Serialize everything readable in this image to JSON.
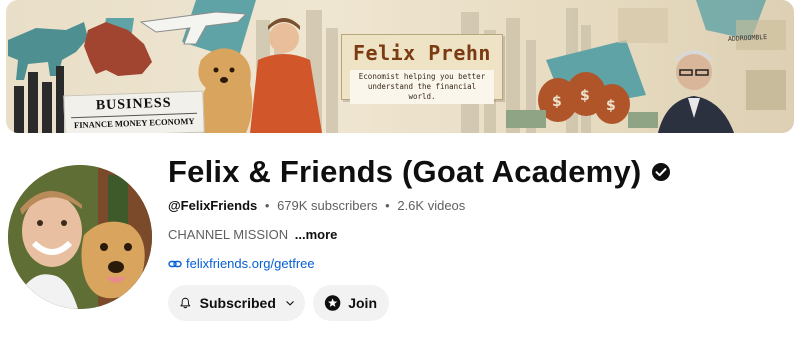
{
  "banner": {
    "name": "Felix Prehn",
    "tagline": "Economist helping you better understand the financial world.",
    "newspaper_head": "BUSINESS",
    "newspaper_sub": "FINANCE MONEY ECONOMY",
    "sign_text": "ADDROOMBLE",
    "colors": {
      "teal": "#5fa3a6",
      "sand": "#ece2cb",
      "brown": "#b0552a",
      "bear": "#9a3f2a"
    }
  },
  "channel": {
    "title": "Felix & Friends (Goat Academy)",
    "verified_icon": "verified-check-icon",
    "handle": "@FelixFriends",
    "separator": "•",
    "subscribers": "679K subscribers",
    "videos": "2.6K videos",
    "description_preview": "CHANNEL MISSION",
    "more_label": "...more",
    "link_icon": "link-icon",
    "link_text": "felixfriends.org/getfree"
  },
  "actions": {
    "subscribe": {
      "icon": "bell-icon",
      "label": "Subscribed",
      "menu_icon": "chevron-down-icon"
    },
    "join": {
      "icon": "star-badge-icon",
      "label": "Join"
    }
  },
  "colors": {
    "link": "#065fd4",
    "button_bg": "#f2f2f2",
    "secondary_text": "#606060",
    "text": "#0f0f0f"
  }
}
